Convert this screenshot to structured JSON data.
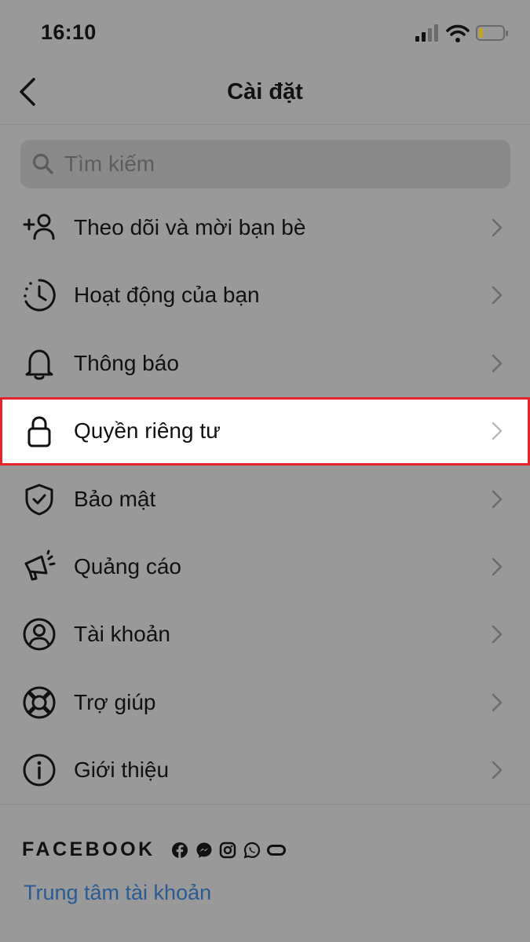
{
  "status_bar": {
    "time": "16:10",
    "icons": [
      "cellular-signal-icon",
      "wifi-icon",
      "battery-icon"
    ]
  },
  "header": {
    "title": "Cài đặt",
    "back_icon": "chevron-left-icon"
  },
  "search": {
    "placeholder": "Tìm kiếm",
    "value": "",
    "icon": "search-icon"
  },
  "menu": {
    "items": [
      {
        "label": "Theo dõi và mời bạn bè",
        "icon": "add-person-icon"
      },
      {
        "label": "Hoạt động của bạn",
        "icon": "activity-clock-icon"
      },
      {
        "label": "Thông báo",
        "icon": "bell-icon"
      },
      {
        "label": "Quyền riêng tư",
        "icon": "lock-icon",
        "highlighted": true
      },
      {
        "label": "Bảo mật",
        "icon": "shield-check-icon"
      },
      {
        "label": "Quảng cáo",
        "icon": "megaphone-icon"
      },
      {
        "label": "Tài khoản",
        "icon": "account-circle-icon"
      },
      {
        "label": "Trợ giúp",
        "icon": "lifebuoy-icon"
      },
      {
        "label": "Giới thiệu",
        "icon": "info-icon"
      }
    ]
  },
  "footer": {
    "brand": "FACEBOOK",
    "brand_icons": [
      "facebook-icon",
      "messenger-icon",
      "instagram-icon",
      "whatsapp-icon",
      "oculus-icon"
    ],
    "accounts_center_link": "Trung tâm tài khoản"
  },
  "colors": {
    "background": "#999999",
    "highlight_border": "#e3242b",
    "link": "#2a5c93"
  }
}
